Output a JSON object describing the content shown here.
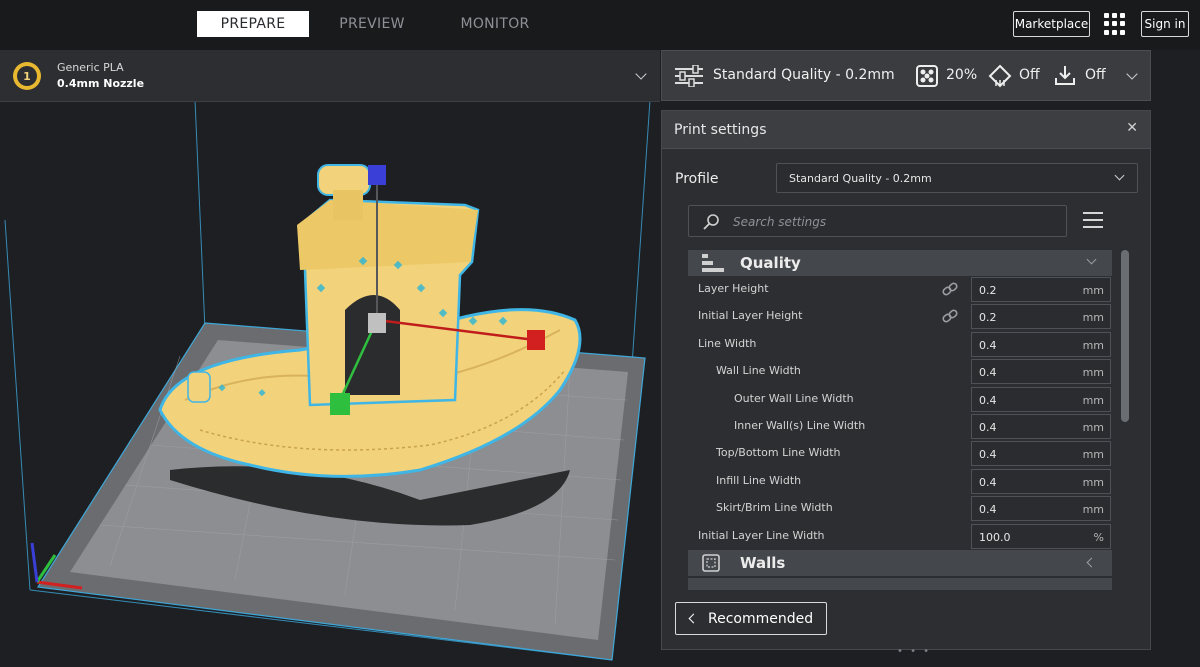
{
  "nav": {
    "tabs": [
      {
        "label": "PREPARE",
        "active": true
      },
      {
        "label": "PREVIEW",
        "active": false
      },
      {
        "label": "MONITOR",
        "active": false
      }
    ],
    "marketplace_label": "Marketplace",
    "apps_icon": "grid-icon",
    "signin_label": "Sign in"
  },
  "extruder": {
    "number": "1",
    "material": "Generic PLA",
    "nozzle": "0.4mm Nozzle"
  },
  "quality_bar": {
    "profile": "Standard Quality - 0.2mm",
    "infill": "20%",
    "support": "Off",
    "adhesion": "Off"
  },
  "print_settings": {
    "title": "Print settings",
    "profile_label": "Profile",
    "profile_value": "Standard Quality - 0.2mm",
    "search_placeholder": "Search settings",
    "categories": [
      {
        "name": "Quality",
        "expanded": true,
        "settings": [
          {
            "label": "Layer Height",
            "value": "0.2",
            "unit": "mm",
            "linked": true,
            "indent": 0
          },
          {
            "label": "Initial Layer Height",
            "value": "0.2",
            "unit": "mm",
            "linked": true,
            "indent": 0
          },
          {
            "label": "Line Width",
            "value": "0.4",
            "unit": "mm",
            "linked": false,
            "indent": 0
          },
          {
            "label": "Wall Line Width",
            "value": "0.4",
            "unit": "mm",
            "linked": false,
            "indent": 1
          },
          {
            "label": "Outer Wall Line Width",
            "value": "0.4",
            "unit": "mm",
            "linked": false,
            "indent": 2
          },
          {
            "label": "Inner Wall(s) Line Width",
            "value": "0.4",
            "unit": "mm",
            "linked": false,
            "indent": 2
          },
          {
            "label": "Top/Bottom Line Width",
            "value": "0.4",
            "unit": "mm",
            "linked": false,
            "indent": 1
          },
          {
            "label": "Infill Line Width",
            "value": "0.4",
            "unit": "mm",
            "linked": false,
            "indent": 1
          },
          {
            "label": "Skirt/Brim Line Width",
            "value": "0.4",
            "unit": "mm",
            "linked": false,
            "indent": 1
          },
          {
            "label": "Initial Layer Line Width",
            "value": "100.0",
            "unit": "%",
            "linked": false,
            "indent": 0
          }
        ]
      },
      {
        "name": "Walls",
        "expanded": false,
        "settings": []
      }
    ],
    "recommended_label": "Recommended"
  },
  "colors": {
    "model": "#f2d27a",
    "model_outline": "#3fb6e6",
    "accent_selected": "#ffffff",
    "axis_x": "#d21f1f",
    "axis_y": "#2fbf3f",
    "axis_z": "#3a3fd8"
  }
}
